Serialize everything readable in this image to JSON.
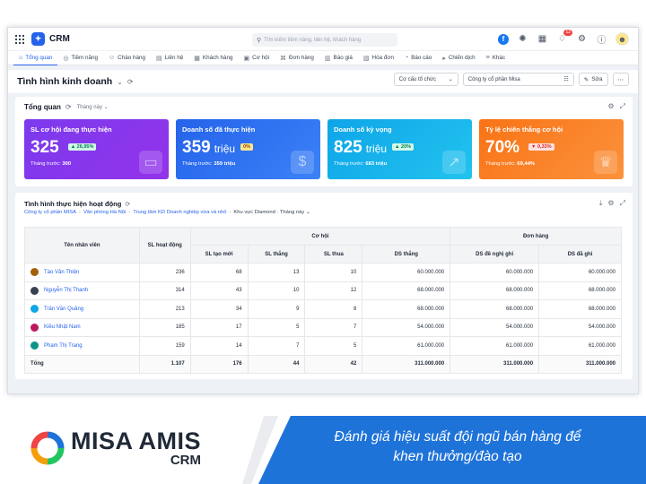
{
  "app": {
    "title": "CRM",
    "logo_letter": "✦"
  },
  "search": {
    "placeholder": "Tìm kiếm tiềm năng, liên hệ, khách hàng"
  },
  "top_icons": {
    "notification_count": "12"
  },
  "nav": [
    {
      "label": "Tổng quan",
      "icon": "home-icon",
      "active": true
    },
    {
      "label": "Tiềm năng",
      "icon": "target-icon"
    },
    {
      "label": "Chào hàng",
      "icon": "handshake-icon"
    },
    {
      "label": "Liên hệ",
      "icon": "contact-icon"
    },
    {
      "label": "Khách hàng",
      "icon": "company-icon"
    },
    {
      "label": "Cơ hội",
      "icon": "briefcase-icon"
    },
    {
      "label": "Đơn hàng",
      "icon": "cart-icon"
    },
    {
      "label": "Báo giá",
      "icon": "quote-icon"
    },
    {
      "label": "Hóa đơn",
      "icon": "invoice-icon"
    },
    {
      "label": "Báo cáo",
      "icon": "report-icon"
    },
    {
      "label": "Chiến dịch",
      "icon": "campaign-icon"
    },
    {
      "label": "Khác",
      "icon": "menu-icon"
    }
  ],
  "page": {
    "title": "Tình hình kinh doanh",
    "org_select": "Cơ cấu tổ chức",
    "company_select": "Công ty cổ phần Misa",
    "edit_label": "Sửa",
    "more_label": "⋯"
  },
  "overview": {
    "title": "Tổng quan",
    "period": "Tháng này",
    "cards": [
      {
        "label": "SL cơ hội đang thực hiện",
        "value": "325",
        "unit": "",
        "badge": "▲ 26,95%",
        "prev_label": "Tháng trước:",
        "prev_value": "300",
        "color_from": "#7c3aed",
        "color_to": "#9333ea",
        "badge_bg": "#d1fae5",
        "badge_color": "#047857",
        "deco": "wallet-icon"
      },
      {
        "label": "Doanh số đã thực hiện",
        "value": "359",
        "unit": "triệu",
        "badge": "0%",
        "prev_label": "Tháng trước:",
        "prev_value": "359 triệu",
        "color_from": "#2563eb",
        "color_to": "#3b82f6",
        "badge_bg": "#fde68a",
        "badge_color": "#92400e",
        "deco": "dollar-icon"
      },
      {
        "label": "Doanh số kỳ vọng",
        "value": "825",
        "unit": "triệu",
        "badge": "▲ 20%",
        "prev_label": "Tháng trước:",
        "prev_value": "683 triệu",
        "color_from": "#0ea5e9",
        "color_to": "#22c3ee",
        "badge_bg": "#d1fae5",
        "badge_color": "#047857",
        "deco": "trend-icon"
      },
      {
        "label": "Tỷ lệ chiến thắng cơ hội",
        "value": "70%",
        "unit": "",
        "badge": "▼ 0,33%",
        "prev_label": "Tháng trước:",
        "prev_value": "69,44%",
        "color_from": "#f97316",
        "color_to": "#fb923c",
        "badge_bg": "#fee2e2",
        "badge_color": "#dc2626",
        "deco": "crown-icon"
      }
    ]
  },
  "activity": {
    "title": "Tình hình thực hiện hoạt động",
    "breadcrumb": [
      "Công ty cổ phần MISA",
      "Văn phòng Hà Nội",
      "Trung tâm KD Doanh nghiệp vừa và nhỏ"
    ],
    "region": "Khu vực Diamond",
    "period": "Tháng này",
    "headers": {
      "employee": "Tên nhân viên",
      "activities": "SL hoạt động",
      "opportunity_group": "Cơ hội",
      "order_group": "Đơn hàng",
      "new": "SL tạo mới",
      "won": "SL thắng",
      "lost": "SL thua",
      "won_sales": "DS thắng",
      "proposed_sales": "DS đề nghị ghi",
      "recorded_sales": "DS đã ghi"
    },
    "rows": [
      {
        "name": "Tào Văn Thiện",
        "activities": "236",
        "new": "68",
        "won": "13",
        "lost": "10",
        "won_sales": "60.000.000",
        "proposed": "60.000.000",
        "recorded": "60.000.000"
      },
      {
        "name": "Nguyễn Thị Thanh",
        "activities": "314",
        "new": "43",
        "won": "10",
        "lost": "12",
        "won_sales": "68.000.000",
        "proposed": "68.000.000",
        "recorded": "68.000.000"
      },
      {
        "name": "Trần Văn Quảng",
        "activities": "213",
        "new": "34",
        "won": "9",
        "lost": "8",
        "won_sales": "68.000.000",
        "proposed": "68.000.000",
        "recorded": "68.000.000"
      },
      {
        "name": "Kiều Nhật Nam",
        "activities": "185",
        "new": "17",
        "won": "5",
        "lost": "7",
        "won_sales": "54.000.000",
        "proposed": "54.000.000",
        "recorded": "54.000.000"
      },
      {
        "name": "Phạm Thị Trang",
        "activities": "159",
        "new": "14",
        "won": "7",
        "lost": "5",
        "won_sales": "61.000.000",
        "proposed": "61.000.000",
        "recorded": "61.000.000"
      }
    ],
    "total": {
      "label": "Tổng",
      "activities": "1.107",
      "new": "176",
      "won": "44",
      "lost": "42",
      "won_sales": "311.000.000",
      "proposed": "311.000.000",
      "recorded": "311.000.000"
    }
  },
  "branding": {
    "name": "MISA AMIS",
    "product": "CRM",
    "tagline_line1": "Đánh giá hiệu suất đội ngũ bán hàng để",
    "tagline_line2": "khen thưởng/đào tạo"
  }
}
